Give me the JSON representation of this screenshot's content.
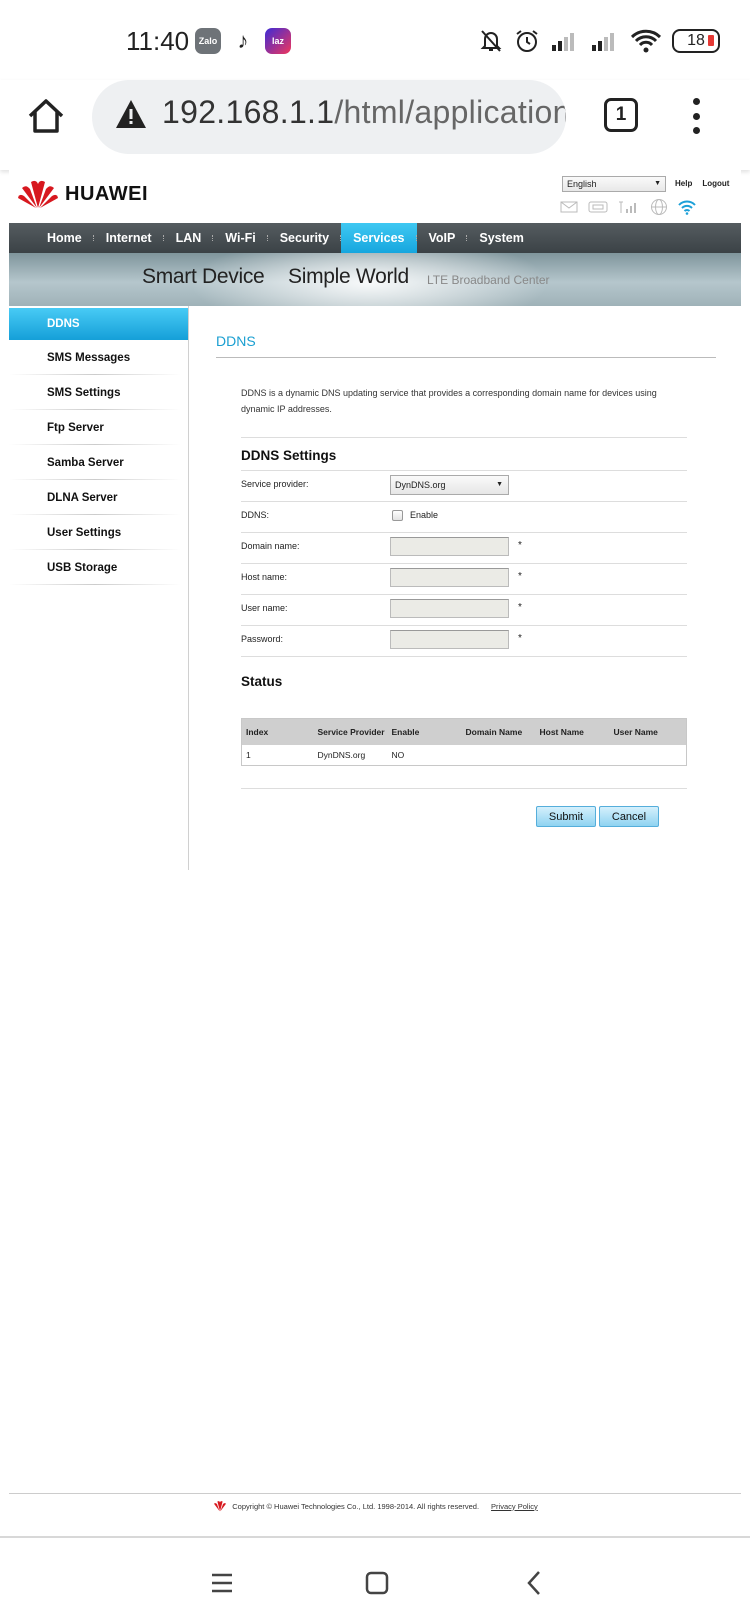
{
  "status_bar": {
    "time": "11:40",
    "apps": [
      {
        "name": "Zalo",
        "label": "Zalo"
      },
      {
        "name": "TikTok",
        "label": "♪"
      },
      {
        "name": "Lazada",
        "label": "laz"
      }
    ],
    "battery": "18",
    "icons": [
      "muted-bell-icon",
      "alarm-icon",
      "signal-icon",
      "signal-icon",
      "wifi-icon",
      "battery-icon"
    ]
  },
  "browser": {
    "url_host": "192.168.1.1",
    "url_path": "/html/application",
    "tab_count": "1",
    "icons": [
      "home-icon",
      "warning-icon",
      "tabs-icon",
      "more-menu-icon"
    ]
  },
  "router": {
    "brand": "HUAWEI",
    "language": "English",
    "help": "Help",
    "logout": "Logout",
    "nav": [
      "Home",
      "Internet",
      "LAN",
      "Wi-Fi",
      "Security",
      "Services",
      "VoIP",
      "System"
    ],
    "nav_active": "Services",
    "slogan_1": "Smart Device",
    "slogan_2": "Simple World",
    "slogan_lte": "LTE  Broadband  Center",
    "sidebar": [
      "DDNS",
      "SMS Messages",
      "SMS Settings",
      "Ftp Server",
      "Samba Server",
      "DLNA Server",
      "User Settings",
      "USB Storage"
    ],
    "sidebar_active": "DDNS",
    "page_title": "DDNS",
    "description": "DDNS is a dynamic DNS updating service that provides a corresponding domain name for devices using dynamic IP addresses.",
    "settings_title": "DDNS Settings",
    "fields": {
      "service_provider_label": "Service provider:",
      "service_provider_value": "DynDNS.org",
      "ddns_label": "DDNS:",
      "ddns_enable_label": "Enable",
      "ddns_enabled": false,
      "domain_label": "Domain name:",
      "host_label": "Host name:",
      "user_label": "User name:",
      "password_label": "Password:",
      "required_mark": "*"
    },
    "status_title": "Status",
    "status_table": {
      "headers": [
        "Index",
        "Service Provider",
        "Enable",
        "Domain Name",
        "Host Name",
        "User Name"
      ],
      "rows": [
        [
          "1",
          "DynDNS.org",
          "NO",
          "",
          "",
          ""
        ]
      ]
    },
    "submit": "Submit",
    "cancel": "Cancel",
    "copyright": "Copyright © Huawei Technologies Co., Ltd. 1998-2014. All rights reserved.",
    "privacy": "Privacy Policy",
    "accent_color": "#1a9fd1"
  },
  "system_nav": [
    "recents-icon",
    "home-square-icon",
    "back-icon"
  ]
}
